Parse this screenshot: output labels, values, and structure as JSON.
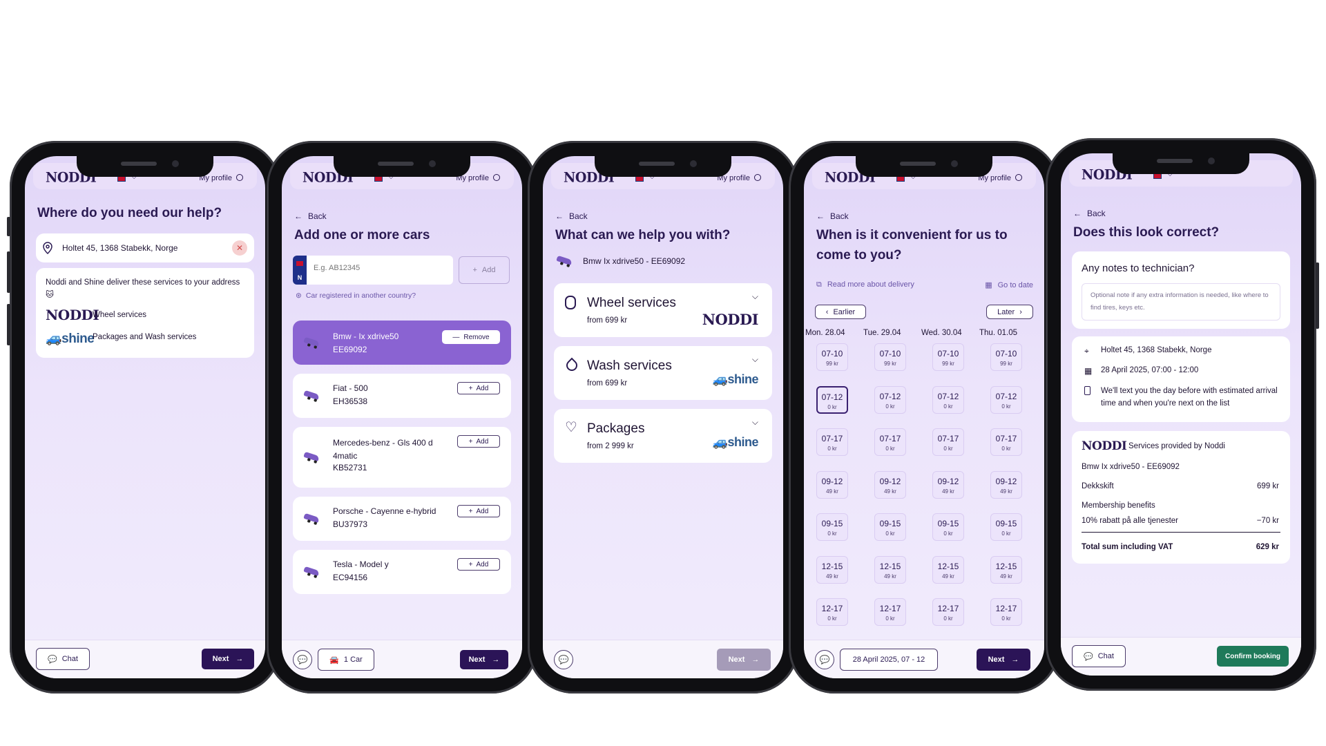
{
  "common": {
    "logo": "NODDI",
    "profile": "My profile",
    "back": "Back",
    "chat": "Chat",
    "next": "Next"
  },
  "s1": {
    "title": "Where do you need our help?",
    "address": "Holtet 45, 1368 Stabekk, Norge",
    "info": "Noddi and Shine deliver these services to your address 🐱",
    "providers": [
      {
        "logo": "NODDI",
        "label": "Wheel services"
      },
      {
        "logo": "shine",
        "label": "Packages and Wash services"
      }
    ]
  },
  "s2": {
    "title": "Add one or more cars",
    "plate_placeholder": "E.g. AB12345",
    "plate_country": "N",
    "add": "Add",
    "foreign_link": "Car registered in another country?",
    "selected_car": {
      "name": "Bmw - Ix xdrive50",
      "plate": "EE69092",
      "action": "Remove"
    },
    "cars": [
      {
        "name": "Fiat - 500",
        "plate": "EH36538",
        "action": "Add"
      },
      {
        "name": "Mercedes-benz - Gls 400 d 4matic",
        "plate": "KB52731",
        "action": "Add"
      },
      {
        "name": "Porsche - Cayenne e-hybrid",
        "plate": "BU37973",
        "action": "Add"
      },
      {
        "name": "Tesla - Model y",
        "plate": "EC94156",
        "action": "Add"
      }
    ],
    "car_count": "1 Car"
  },
  "s3": {
    "title": "What can we help you with?",
    "car": "Bmw Ix xdrive50 - EE69092",
    "services": [
      {
        "name": "Wheel services",
        "price": "from 699 kr",
        "logo": "NODDI",
        "icon": "tire-icon"
      },
      {
        "name": "Wash services",
        "price": "from 699 kr",
        "logo": "shine",
        "icon": "drop-icon"
      },
      {
        "name": "Packages",
        "price": "from 2 999 kr",
        "logo": "shine",
        "icon": "heart-icon"
      }
    ]
  },
  "s4": {
    "title_line1": "When is it convenient for us to",
    "title_line2": "come to you?",
    "read_more": "Read more about delivery",
    "go_to_date": "Go to date",
    "earlier": "Earlier",
    "later": "Later",
    "days": [
      "Mon. 28.04",
      "Tue. 29.04",
      "Wed. 30.04",
      "Thu. 01.05"
    ],
    "slots": [
      {
        "time": "07-10",
        "price": "99 kr"
      },
      {
        "time": "07-12",
        "price": "0 kr"
      },
      {
        "time": "07-17",
        "price": "0 kr"
      },
      {
        "time": "09-12",
        "price": "49 kr"
      },
      {
        "time": "09-15",
        "price": "0 kr"
      },
      {
        "time": "12-15",
        "price": "49 kr"
      },
      {
        "time": "12-17",
        "price": "0 kr"
      }
    ],
    "selected_summary": "28 April 2025, 07 - 12"
  },
  "s5": {
    "title": "Does this look correct?",
    "notes_title": "Any notes to technician?",
    "notes_placeholder": "Optional note if any extra information is needed, like where to find tires, keys etc.",
    "address": "Holtet 45, 1368 Stabekk, Norge",
    "datetime": "28 April 2025, 07:00 - 12:00",
    "sms_info": "We'll text you the day before with estimated arrival time and when you're next on the list",
    "provider_logo": "NODDI",
    "provider_text": "Services provided by Noddi",
    "car": "Bmw Ix xdrive50 - EE69092",
    "line_item": {
      "label": "Dekkskift",
      "amount": "699 kr"
    },
    "benefits_title": "Membership benefits",
    "benefit": {
      "label": "10% rabatt på alle tjenester",
      "amount": "−70 kr"
    },
    "total": {
      "label": "Total sum including VAT",
      "amount": "629 kr"
    },
    "confirm": "Confirm booking"
  },
  "colors": {
    "primary": "#2b1457",
    "accent": "#8a63d2",
    "confirm": "#1f7a5a",
    "screen_bg": "#e9e0fa"
  }
}
